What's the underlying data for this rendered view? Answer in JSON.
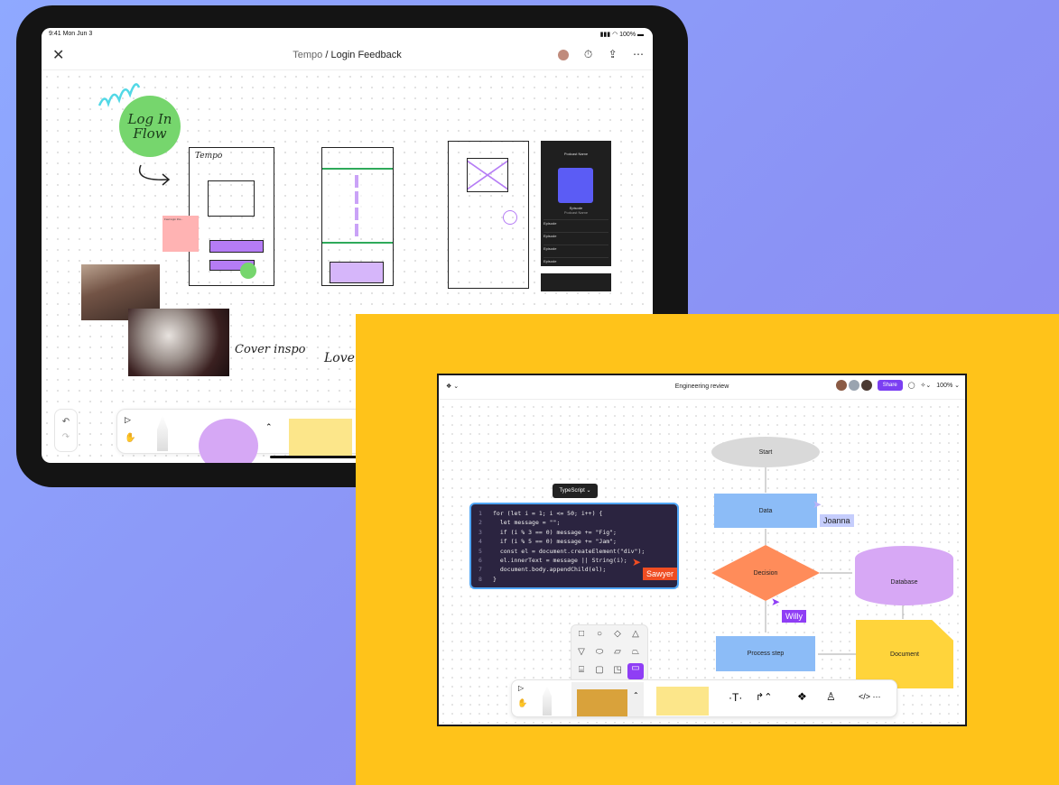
{
  "ipad": {
    "status_time": "9:41 Mon Jun 3",
    "status_right": "100%",
    "project": "Tempo",
    "separator": "/",
    "file": "Login Feedback",
    "sticker_text": "Log In Flow",
    "tempo_label": "Tempo",
    "cover_label": "Cover inspo",
    "love_label": "Love",
    "pink_note": "Fast login this...",
    "podcast": {
      "name": "Podcast Name",
      "episode_title": "Episode",
      "episode_sub": "Podcast Name",
      "episodes": [
        "Episode",
        "Episode",
        "Episode",
        "Episode"
      ]
    }
  },
  "figma": {
    "title": "Engineering review",
    "share_label": "Share",
    "zoom": "100%",
    "language": "TypeScript",
    "code_lines": [
      {
        "n": "1",
        "t": "for (let i = 1; i <= 50; i++) {"
      },
      {
        "n": "2",
        "t": "  let message = \"\";"
      },
      {
        "n": "3",
        "t": "  if (i % 3 == 0) message += \"Fig\";"
      },
      {
        "n": "4",
        "t": "  if (i % 5 == 0) message += \"Jam\";"
      },
      {
        "n": "5",
        "t": "  const el = document.createElement(\"div\");"
      },
      {
        "n": "6",
        "t": "  el.innerText = message || String(i);"
      },
      {
        "n": "7",
        "t": "  document.body.appendChild(el);"
      },
      {
        "n": "8",
        "t": "}"
      }
    ],
    "nodes": {
      "start": "Start",
      "data": "Data",
      "decision": "Decision",
      "database": "Database",
      "process": "Process step",
      "document": "Document"
    },
    "cursors": {
      "joanna": "Joanna",
      "sawyer": "Sawyer",
      "willy": "Willy"
    },
    "colors": {
      "accent": "#7b3ff2",
      "node_blue": "#8cbcf7",
      "node_orange": "#ff8c5a",
      "node_purple": "#d7a8f5",
      "node_yellow": "#ffd43b",
      "node_gray": "#d9d9d9",
      "panel_yellow": "#ffc31a"
    }
  }
}
